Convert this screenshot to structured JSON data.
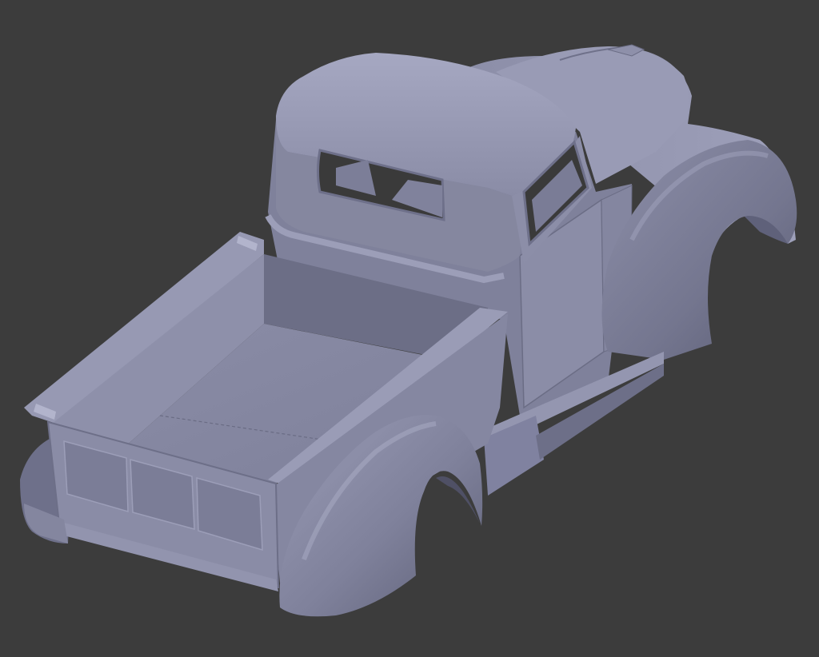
{
  "scene": {
    "subject": "truck-body-model",
    "colors": {
      "background": "#3c3c3c",
      "body_light": "#9ea0ba",
      "body_mid": "#8587a1",
      "body_dark": "#676982",
      "body_shadow": "#4f5065",
      "glass_dark": "#3a3a3a",
      "edge": "#5c5d73"
    }
  }
}
